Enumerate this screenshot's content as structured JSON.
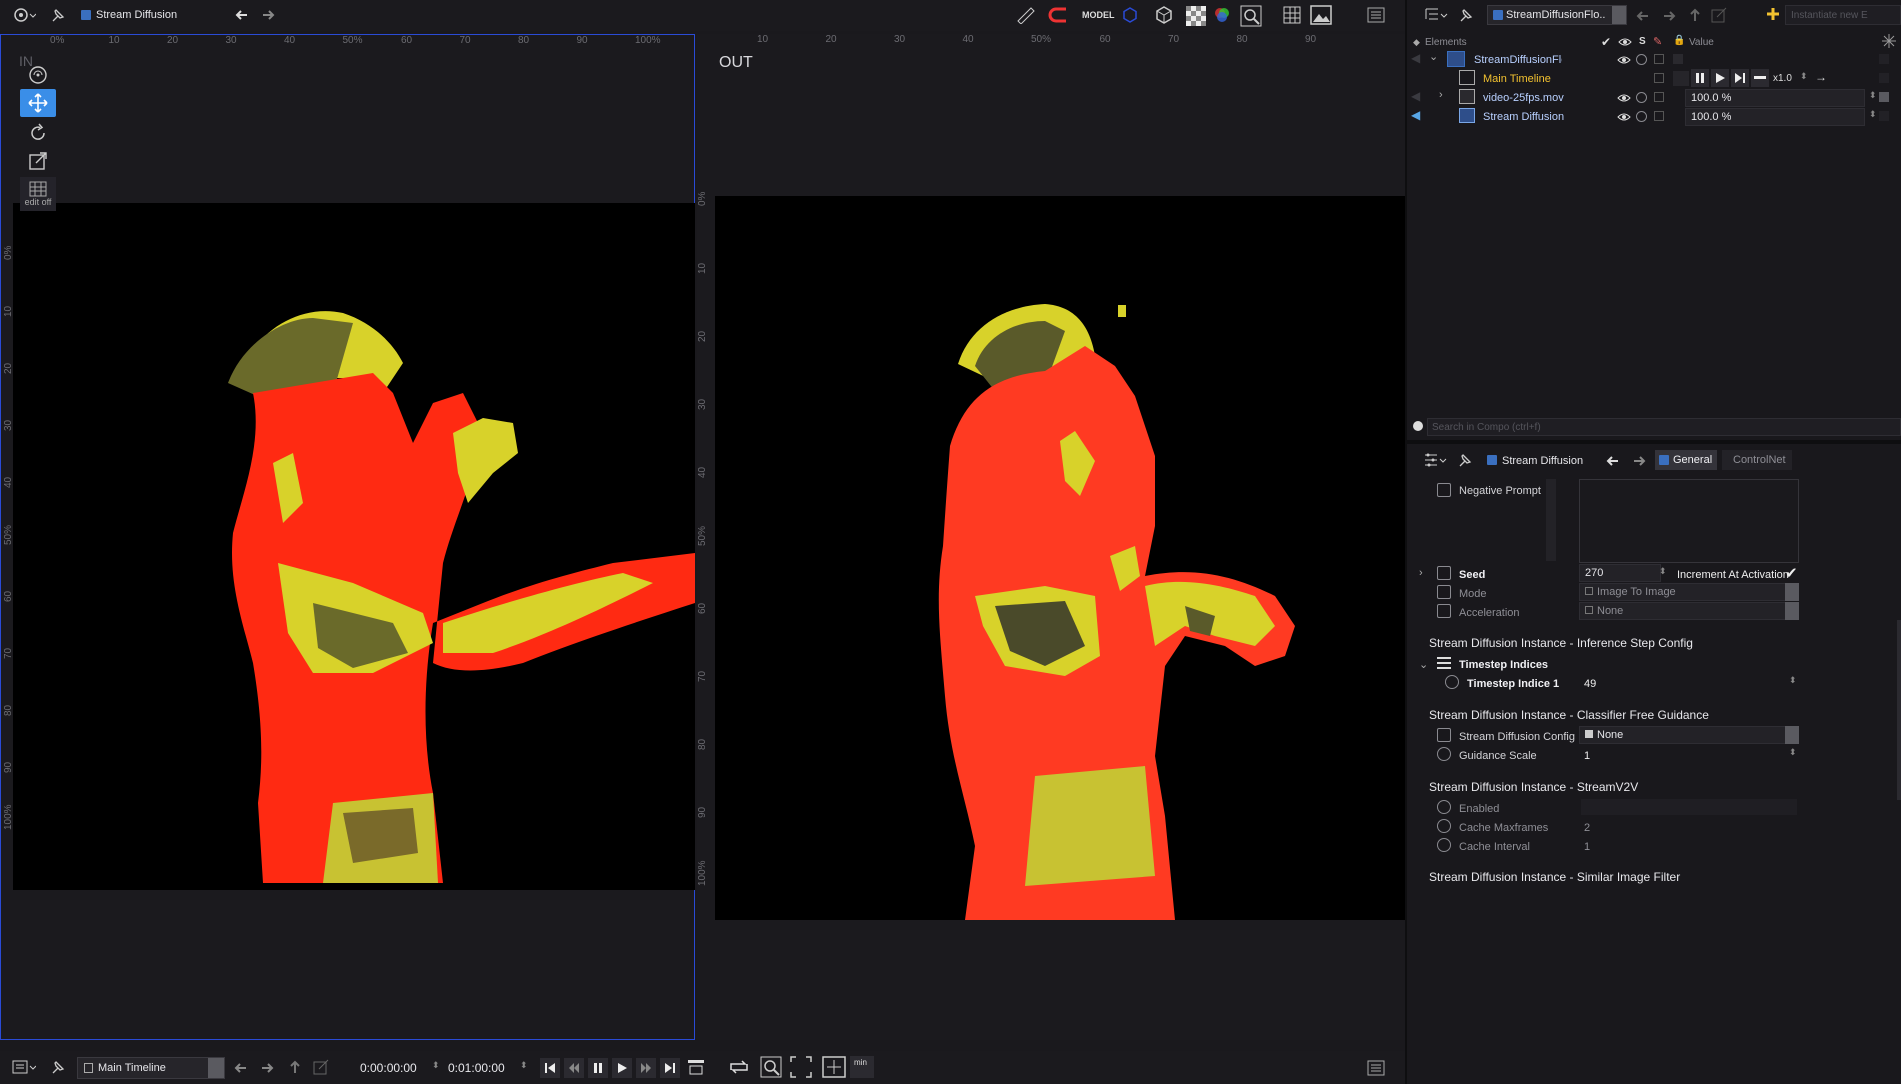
{
  "topbar": {
    "title": "Stream Diffusion",
    "model_label": "MODEL"
  },
  "viewer_in": {
    "label": "IN",
    "ruler_x": [
      "0%",
      "10",
      "20",
      "30",
      "40",
      "50%",
      "60",
      "70",
      "80",
      "90",
      "100%"
    ],
    "ruler_y": [
      "0%",
      "10",
      "20",
      "30",
      "40",
      "50%",
      "60",
      "70",
      "80",
      "90",
      "100%"
    ],
    "edit_label": "edit off"
  },
  "viewer_out": {
    "label": "OUT",
    "ruler_x": [
      "10",
      "20",
      "30",
      "40",
      "50%",
      "60",
      "70",
      "80",
      "90"
    ],
    "ruler_y": [
      "0%",
      "10",
      "20",
      "30",
      "40",
      "50%",
      "60",
      "70",
      "80",
      "90",
      "100%"
    ]
  },
  "right_top": {
    "compo_select": "StreamDiffusionFlo...",
    "instantiate_placeholder": "Instantiate new E",
    "header": {
      "elements": "Elements",
      "s": "S",
      "value": "Value"
    },
    "tree": [
      {
        "name": "StreamDiffusionFlow",
        "value": ""
      },
      {
        "name": "Main Timeline",
        "value": "",
        "speed": "x1.0"
      },
      {
        "name": "video-25fps.mov",
        "value": "100.0 %"
      },
      {
        "name": "Stream Diffusion",
        "value": "100.0 %"
      }
    ],
    "search_placeholder": "Search in Compo (ctrl+f)"
  },
  "inspector": {
    "title": "Stream Diffusion",
    "tabs": [
      "General",
      "ControlNet"
    ],
    "negative_prompt_label": "Negative Prompt",
    "seed_label": "Seed",
    "seed_value": "270",
    "increment_label": "Increment At Activation",
    "mode_label": "Mode",
    "mode_value": "Image To Image",
    "accel_label": "Acceleration",
    "accel_value": "None",
    "section1": "Stream Diffusion Instance - Inference Step Config",
    "timestep_indices": "Timestep Indices",
    "timestep_indice_1": "Timestep Indice 1",
    "timestep_indice_1_value": "49",
    "section2": "Stream Diffusion Instance - Classifier Free Guidance",
    "sd_config_label": "Stream Diffusion Config",
    "sd_config_value": "None",
    "guidance_label": "Guidance Scale",
    "guidance_value": "1",
    "section3": "Stream Diffusion Instance - StreamV2V",
    "enabled_label": "Enabled",
    "cache_maxframes_label": "Cache Maxframes",
    "cache_maxframes_value": "2",
    "cache_interval_label": "Cache Interval",
    "cache_interval_value": "1",
    "section4": "Stream Diffusion Instance - Similar Image Filter"
  },
  "bottombar": {
    "timeline_select": "Main Timeline",
    "time_current": "0:00:00:00",
    "time_duration": "0:01:00:00",
    "min_label": "min"
  },
  "colors": {
    "accent": "#3a8ee8",
    "selection_border": "#2a4bd6",
    "thermal_red": "#ff2a12",
    "thermal_yellow": "#d8d22a"
  }
}
